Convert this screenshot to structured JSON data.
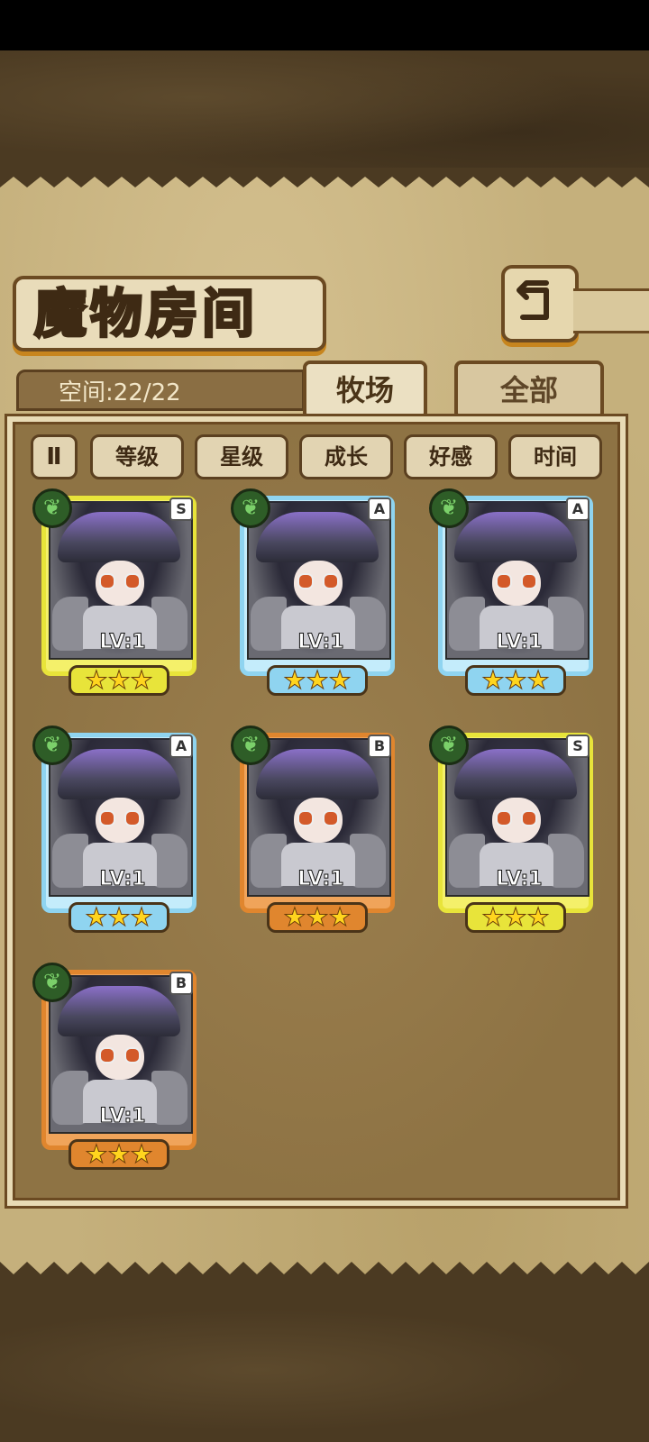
{
  "title": "魔物房间",
  "space": {
    "label": "空间:22/22"
  },
  "tabs": [
    {
      "label": "牧场",
      "active": true
    },
    {
      "label": "全部",
      "active": false
    }
  ],
  "sort": {
    "toggle_icon": "Ⅱ",
    "buttons": [
      "等级",
      "星级",
      "成长",
      "好感",
      "时间"
    ]
  },
  "monsters": [
    {
      "grade": "S",
      "level": "LV:1",
      "stars": "★★★"
    },
    {
      "grade": "A",
      "level": "LV:1",
      "stars": "★★★"
    },
    {
      "grade": "A",
      "level": "LV:1",
      "stars": "★★★"
    },
    {
      "grade": "A",
      "level": "LV:1",
      "stars": "★★★"
    },
    {
      "grade": "B",
      "level": "LV:1",
      "stars": "★★★"
    },
    {
      "grade": "S",
      "level": "LV:1",
      "stars": "★★★"
    },
    {
      "grade": "B",
      "level": "LV:1",
      "stars": "★★★"
    }
  ],
  "icons": {
    "back": "back-arrow-icon",
    "element": "leaf-icon",
    "leaf_glyph": "❦"
  },
  "colors": {
    "grade_S": "#e8e43a",
    "grade_A": "#8fd4f0",
    "grade_B": "#e0862e",
    "frame": "#6b4a22"
  }
}
